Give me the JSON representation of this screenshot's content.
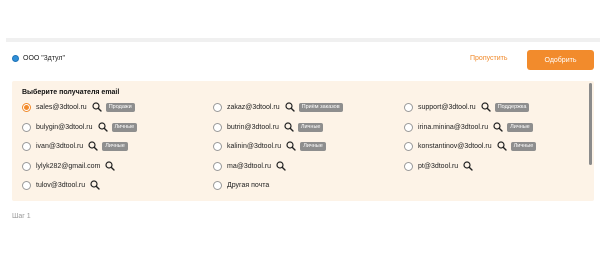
{
  "header": {
    "company": "ООО \"3дтул\"",
    "skip_label": "Пропустить",
    "approve_label": "Одобрить"
  },
  "panel": {
    "title": "Выберите получателя email",
    "options": [
      {
        "email": "sales@3dtool.ru",
        "tag": "Продажи",
        "selected": true
      },
      {
        "email": "zakaz@3dtool.ru",
        "tag": "Приём заказов",
        "selected": false
      },
      {
        "email": "support@3dtool.ru",
        "tag": "Поддержка",
        "selected": false
      },
      {
        "email": "bulygin@3dtool.ru",
        "tag": "Личные",
        "selected": false
      },
      {
        "email": "butrin@3dtool.ru",
        "tag": "Личные",
        "selected": false
      },
      {
        "email": "irina.minina@3dtool.ru",
        "tag": "Личные",
        "selected": false
      },
      {
        "email": "ivan@3dtool.ru",
        "tag": "Личные",
        "selected": false
      },
      {
        "email": "kalinin@3dtool.ru",
        "tag": "Личные",
        "selected": false
      },
      {
        "email": "konstantinov@3dtool.ru",
        "tag": "Личные",
        "selected": false
      },
      {
        "email": "lylyk282@gmail.com",
        "tag": "",
        "selected": false
      },
      {
        "email": "ma@3dtool.ru",
        "tag": "",
        "selected": false
      },
      {
        "email": "pt@3dtool.ru",
        "tag": "",
        "selected": false
      },
      {
        "email": "tulov@3dtool.ru",
        "tag": "",
        "selected": false
      },
      {
        "email": "Другая почта",
        "tag": "",
        "selected": false,
        "no_search": true
      }
    ]
  },
  "step_label": "Шаг 1",
  "colors": {
    "accent": "#f28b2c",
    "panel_bg": "#fdf3e7",
    "tag_bg": "#8e8e8e"
  },
  "icons": {
    "search": "magnifier-icon"
  }
}
